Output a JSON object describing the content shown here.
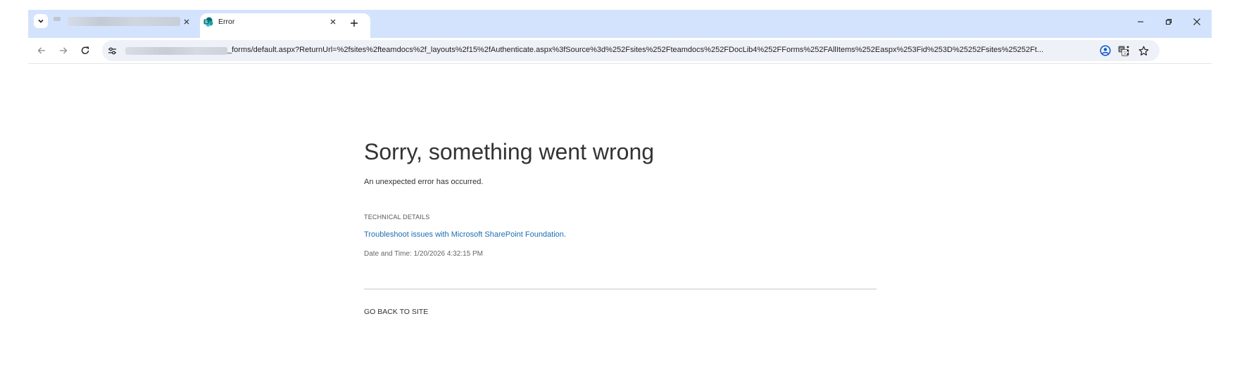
{
  "browser": {
    "tabs": [
      {
        "title": "",
        "active": false
      },
      {
        "title": "Error",
        "active": true
      }
    ],
    "new_tab_label": "+",
    "address": {
      "url_visible": "_forms/default.aspx?ReturnUrl=%2fsites%2fteamdocs%2f_layouts%2f15%2fAuthenticate.aspx%3fSource%3d%252Fsites%252Fteamdocs%252FDocLib4%252FForms%252FAllItems%252Easpx%253Fid%253D%25252Fsites%25252Ft..."
    },
    "icons": {
      "tab_search": "chevron-down-icon",
      "back": "arrow-left-icon",
      "forward": "arrow-right-icon",
      "reload": "reload-icon",
      "site_info": "tune-icon",
      "translate": "translate-icon",
      "bookmark": "star-icon",
      "profile": "profile-icon",
      "menu": "kebab-menu-icon"
    },
    "accent": "#d3e3fd"
  },
  "page": {
    "title": "Sorry, something went wrong",
    "subtitle": "An unexpected error has occurred.",
    "technical_details_heading": "TECHNICAL DETAILS",
    "troubleshoot_link": "Troubleshoot issues with Microsoft SharePoint Foundation.",
    "date_time": "Date and Time: 1/20/2026 4:32:15 PM",
    "go_back": "GO BACK TO SITE",
    "link_color": "#1a6fb5"
  }
}
